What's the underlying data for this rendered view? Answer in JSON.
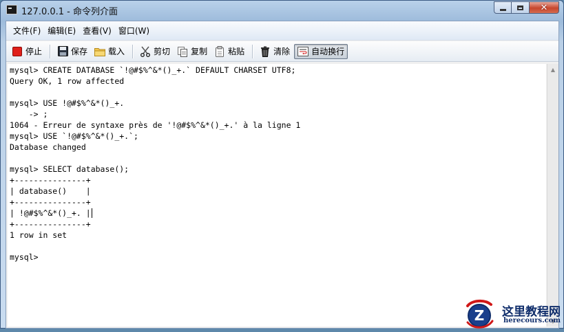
{
  "window": {
    "title": "127.0.0.1 - 命令列介面"
  },
  "menu": [
    {
      "id": "file",
      "label": "文件(F)"
    },
    {
      "id": "edit",
      "label": "编辑(E)"
    },
    {
      "id": "view",
      "label": "查看(V)"
    },
    {
      "id": "window",
      "label": "窗口(W)"
    }
  ],
  "toolbar": {
    "stop": "停止",
    "save": "保存",
    "load": "载入",
    "cut": "剪切",
    "copy": "复制",
    "paste": "粘贴",
    "clear": "清除",
    "wrap": "自动换行"
  },
  "console": {
    "lines": [
      "mysql> CREATE DATABASE `!@#$%^&*()_+.` DEFAULT CHARSET UTF8;",
      "Query OK, 1 row affected",
      "",
      "mysql> USE !@#$%^&*()_+.",
      "    -> ;",
      "1064 - Erreur de syntaxe près de '!@#$%^&*()_+.' à la ligne 1",
      "mysql> USE `!@#$%^&*()_+.`;",
      "Database changed",
      "",
      "mysql> SELECT database();",
      "+---------------+",
      "| database()    |",
      "+---------------+",
      "| !@#$%^&*()_+. |",
      "+---------------+",
      "1 row in set",
      "",
      "mysql>"
    ]
  },
  "watermark": {
    "title": "这里教程网",
    "url": "herecours.com",
    "logo_letter": "Z"
  },
  "colors": {
    "stop_red": "#e0201a",
    "watermark_blue": "#0f2d6b",
    "watermark_red": "#d01818"
  }
}
